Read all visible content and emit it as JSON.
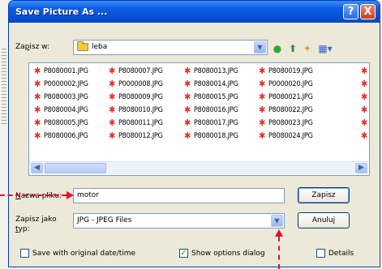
{
  "window": {
    "title": "Save Picture As ...",
    "help_glyph": "?",
    "close_glyph": "X"
  },
  "location": {
    "label_prefix": "Za",
    "label_accel": "p",
    "label_suffix": "isz w:",
    "folder": "leba",
    "icons": [
      "folder-icon",
      "back-icon",
      "up-folder-icon",
      "new-folder-icon",
      "view-menu-icon"
    ]
  },
  "files": [
    [
      "P8080001.JPG",
      "P8080007.JPG",
      "P8080013.JPG",
      "P8080019.JPG"
    ],
    [
      "P0000002.JPG",
      "P0000008.JPG",
      "P8080014.JPG",
      "P0000020.JPG"
    ],
    [
      "P8080003.JPG",
      "P8080009.JPG",
      "P8080015.JPG",
      "P8080021.JPG"
    ],
    [
      "P8080004.JPG",
      "P8080010.JPG",
      "P8080016.JPG",
      "P8080022.JPG"
    ],
    [
      "P8080005.JPG",
      "P8080011.JPG",
      "P8080017.JPG",
      "P8080023.JPG"
    ],
    [
      "P8080006.JPG",
      "P8080012.JPG",
      "P8080018.JPG",
      "P8080024.JPG"
    ]
  ],
  "filename": {
    "label_accel": "N",
    "label_rest": "azwa pliku:",
    "value": "motor"
  },
  "filetype": {
    "label_line1": "Zapisz jako",
    "label_line2_accel": "t",
    "label_line2_rest": "yp:",
    "value": "JPG - JPEG Files"
  },
  "buttons": {
    "save": "Zapisz",
    "cancel": "Anuluj"
  },
  "options": {
    "save_original_date": {
      "label": "Save with original date/time",
      "checked": false
    },
    "show_options_dialog": {
      "label": "Show options dialog",
      "checked": true
    },
    "details": {
      "label": "Details",
      "checked": false
    }
  },
  "colors": {
    "titlebar": "#0552d6",
    "annotation_arrow": "#e2122a",
    "file_icon": "#e0302a"
  }
}
